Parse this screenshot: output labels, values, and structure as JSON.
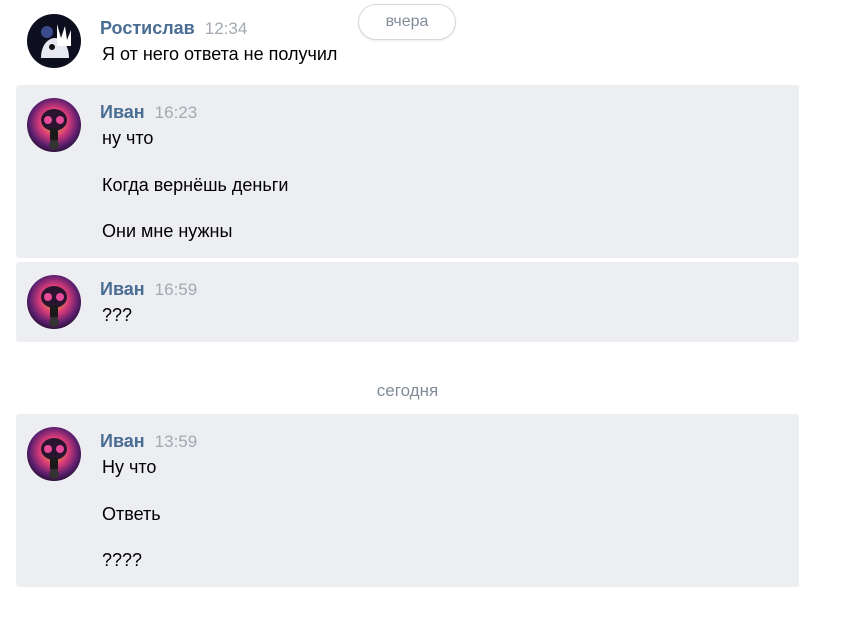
{
  "date_pills": {
    "yesterday": "вчера",
    "today": "сегодня"
  },
  "messages": [
    {
      "author": "Ростислав",
      "time": "12:34",
      "avatar": "rostislav-avatar",
      "lines": [
        "Я от него ответа не получил"
      ],
      "highlighted": false
    },
    {
      "author": "Иван",
      "time": "16:23",
      "avatar": "ivan-avatar",
      "lines": [
        "ну что",
        "Когда вернёшь деньги",
        "Они мне нужны"
      ],
      "highlighted": true
    },
    {
      "author": "Иван",
      "time": "16:59",
      "avatar": "ivan-avatar",
      "lines": [
        "???"
      ],
      "highlighted": true
    },
    {
      "author": "Иван",
      "time": "13:59",
      "avatar": "ivan-avatar",
      "lines": [
        "Ну что",
        "Ответь",
        "????"
      ],
      "highlighted": true
    }
  ],
  "colors": {
    "author": "#4a6d94",
    "time": "#a3a9b0",
    "highlight_bg": "#edeef2",
    "date_text": "#818c99"
  }
}
